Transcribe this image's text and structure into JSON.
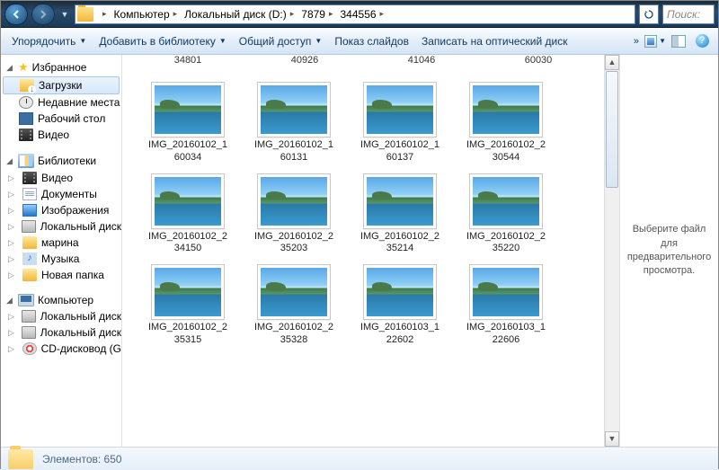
{
  "nav": {
    "breadcrumbs": [
      "Компьютер",
      "Локальный диск (D:)",
      "7879",
      "344556"
    ],
    "search_placeholder": "Поиск:"
  },
  "toolbar": {
    "organize": "Упорядочить",
    "add_library": "Добавить в библиотеку",
    "share": "Общий доступ",
    "slideshow": "Показ слайдов",
    "burn": "Записать на оптический диск"
  },
  "sidebar": {
    "favorites": {
      "label": "Избранное",
      "items": [
        {
          "label": "Загрузки",
          "icon": "folder down",
          "selected": true
        },
        {
          "label": "Недавние места",
          "icon": "clock"
        },
        {
          "label": "Рабочий стол",
          "icon": "desktop"
        },
        {
          "label": "Видео",
          "icon": "video"
        }
      ]
    },
    "libraries": {
      "label": "Библиотеки",
      "items": [
        {
          "label": "Видео",
          "icon": "video"
        },
        {
          "label": "Документы",
          "icon": "doc"
        },
        {
          "label": "Изображения",
          "icon": "pic"
        },
        {
          "label": "Локальный диск",
          "icon": "drive"
        },
        {
          "label": "марина",
          "icon": "folder"
        },
        {
          "label": "Музыка",
          "icon": "music"
        },
        {
          "label": "Новая папка",
          "icon": "folder"
        }
      ]
    },
    "computer": {
      "label": "Компьютер",
      "items": [
        {
          "label": "Локальный диск",
          "icon": "drive"
        },
        {
          "label": "Локальный диск",
          "icon": "drive"
        },
        {
          "label": "CD-дисковод (G",
          "icon": "cd"
        }
      ]
    }
  },
  "partial_row": [
    "34801",
    "40926",
    "41046",
    "60030"
  ],
  "files": [
    {
      "name": "IMG_20160102_160034"
    },
    {
      "name": "IMG_20160102_160131"
    },
    {
      "name": "IMG_20160102_160137"
    },
    {
      "name": "IMG_20160102_230544"
    },
    {
      "name": "IMG_20160102_234150"
    },
    {
      "name": "IMG_20160102_235203"
    },
    {
      "name": "IMG_20160102_235214"
    },
    {
      "name": "IMG_20160102_235220"
    },
    {
      "name": "IMG_20160102_235315"
    },
    {
      "name": "IMG_20160102_235328"
    },
    {
      "name": "IMG_20160103_122602"
    },
    {
      "name": "IMG_20160103_122606"
    }
  ],
  "preview": {
    "text": "Выберите файл для предварительного просмотра."
  },
  "status": {
    "label": "Элементов:",
    "count": "650"
  }
}
